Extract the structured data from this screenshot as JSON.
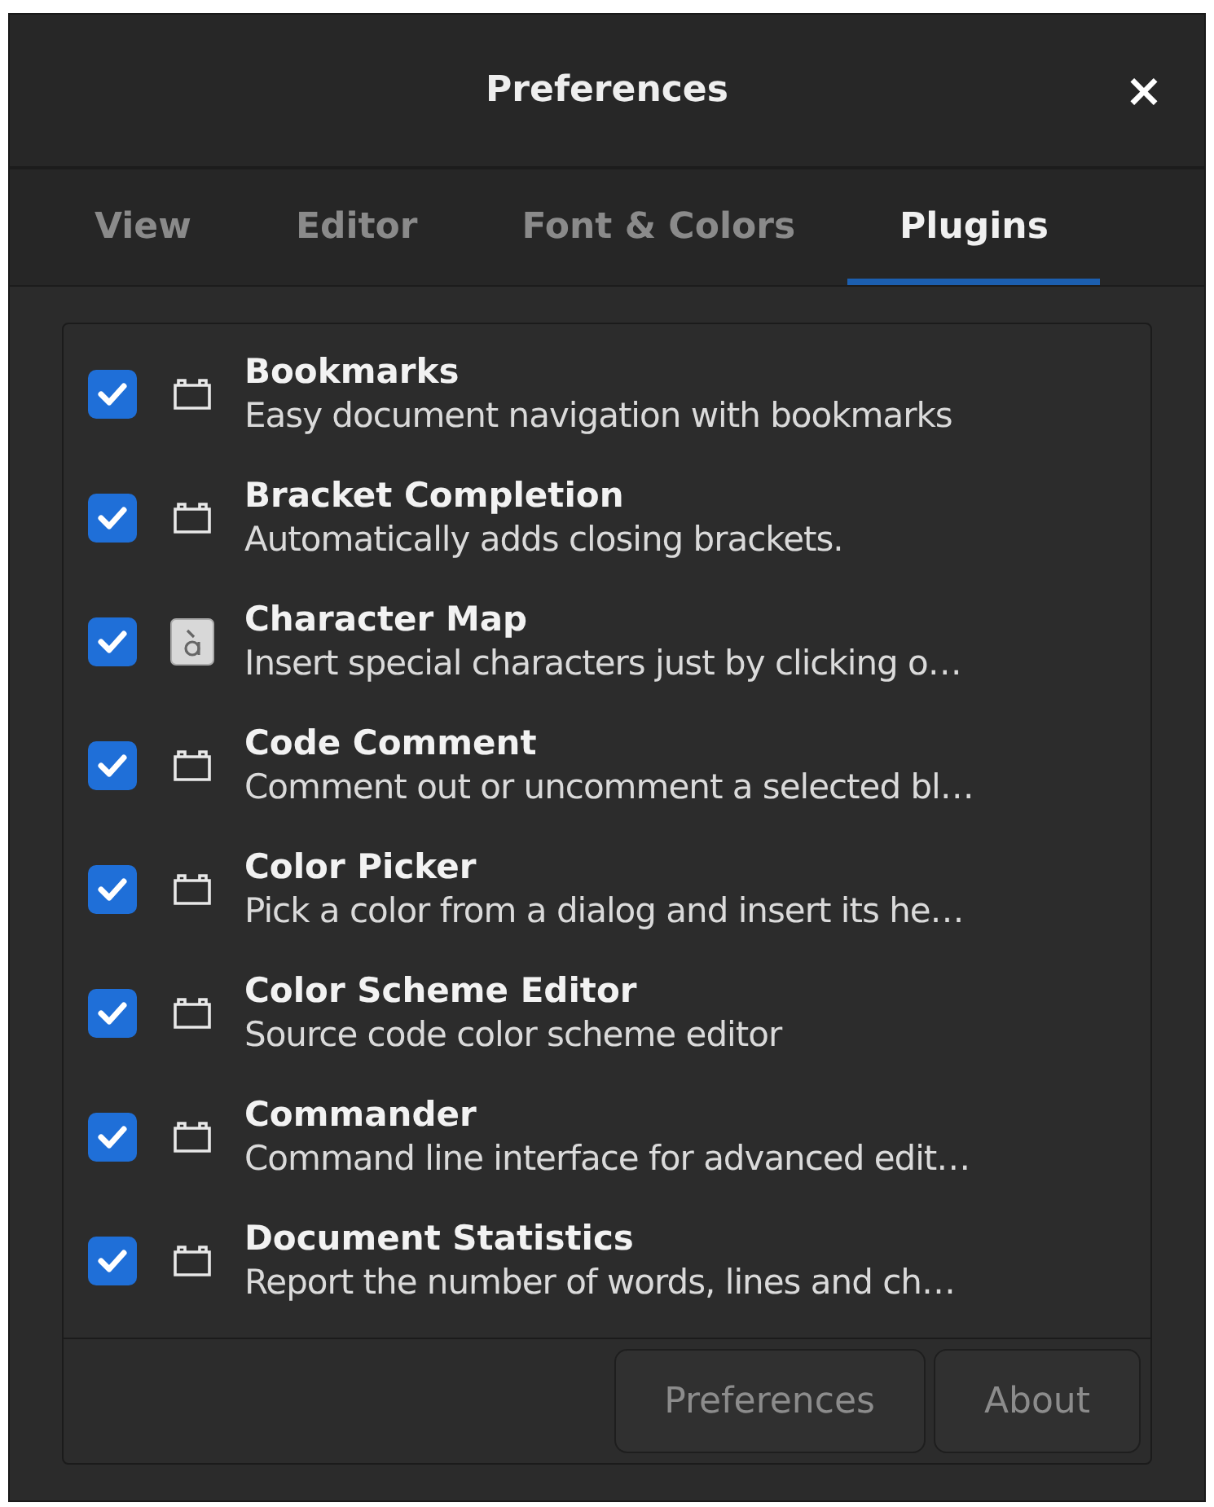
{
  "window": {
    "title": "Preferences",
    "close": "×"
  },
  "tabs": [
    {
      "label": "View",
      "selected": false
    },
    {
      "label": "Editor",
      "selected": false
    },
    {
      "label": "Font & Colors",
      "selected": false
    },
    {
      "label": "Plugins",
      "selected": true
    }
  ],
  "plugins": [
    {
      "name": "Bookmarks",
      "description": "Easy document navigation with bookmarks",
      "checked": true,
      "kind": "generic"
    },
    {
      "name": "Bracket Completion",
      "description": "Automatically adds closing brackets.",
      "checked": true,
      "kind": "generic"
    },
    {
      "name": "Character Map",
      "description": "Insert special characters just by clicking o…",
      "checked": true,
      "kind": "charmap"
    },
    {
      "name": "Code Comment",
      "description": "Comment out or uncomment a selected bl…",
      "checked": true,
      "kind": "generic"
    },
    {
      "name": "Color Picker",
      "description": "Pick a color from a dialog and insert its he…",
      "checked": true,
      "kind": "generic"
    },
    {
      "name": "Color Scheme Editor",
      "description": "Source code color scheme editor",
      "checked": true,
      "kind": "generic"
    },
    {
      "name": "Commander",
      "description": "Command line interface for advanced edit…",
      "checked": true,
      "kind": "generic"
    },
    {
      "name": "Document Statistics",
      "description": "Report the number of words, lines and ch…",
      "checked": true,
      "kind": "generic"
    }
  ],
  "buttons": [
    {
      "label": "Preferences",
      "disabled": true
    },
    {
      "label": "About",
      "disabled": true
    }
  ]
}
